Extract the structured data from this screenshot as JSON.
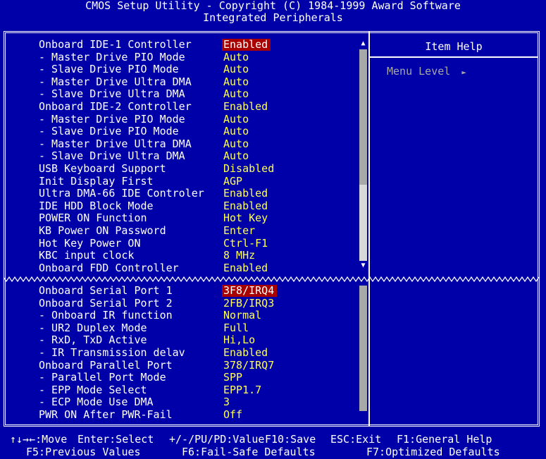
{
  "header": {
    "line1": "CMOS Setup Utility - Copyright (C) 1984-1999 Award Software",
    "line2": "Integrated Peripherals"
  },
  "help": {
    "title": "Item Help",
    "menu_level": "Menu Level"
  },
  "top_items": [
    {
      "label": "Onboard IDE-1 Controller",
      "value": "Enabled",
      "selected": true
    },
    {
      "label": "- Master Drive PIO Mode",
      "value": "Auto"
    },
    {
      "label": "- Slave Drive PIO Mode",
      "value": "Auto"
    },
    {
      "label": "- Master Drive Ultra DMA",
      "value": "Auto"
    },
    {
      "label": "- Slave Drive Ultra DMA",
      "value": "Auto"
    },
    {
      "label": "Onboard IDE-2 Controller",
      "value": "Enabled"
    },
    {
      "label": "- Master Drive PIO Mode",
      "value": "Auto"
    },
    {
      "label": "- Slave Drive PIO Mode",
      "value": "Auto"
    },
    {
      "label": "- Master Drive Ultra DMA",
      "value": "Auto"
    },
    {
      "label": "- Slave Drive Ultra DMA",
      "value": "Auto"
    },
    {
      "label": "USB Keyboard Support",
      "value": "Disabled"
    },
    {
      "label": "Init Display First",
      "value": "AGP"
    },
    {
      "label": "Ultra DMA-66 IDE Controler",
      "value": "Enabled"
    },
    {
      "label": "IDE HDD Block Mode",
      "value": "Enabled"
    },
    {
      "label": "POWER ON Function",
      "value": "Hot Key"
    },
    {
      "label": "KB Power ON Password",
      "value": "Enter"
    },
    {
      "label": "Hot Key Power ON",
      "value": "Ctrl-F1"
    },
    {
      "label": "KBC input clock",
      "value": "8 MHz"
    },
    {
      "label": "Onboard FDD Controller",
      "value": "Enabled"
    }
  ],
  "bottom_items": [
    {
      "label": "Onboard Serial Port 1",
      "value": "3F8/IRQ4",
      "selected": true
    },
    {
      "label": "Onboard Serial Port 2",
      "value": "2FB/IRQ3"
    },
    {
      "label": "- Onboard IR function",
      "value": "Normal"
    },
    {
      "label": "- UR2 Duplex Mode",
      "value": "Full"
    },
    {
      "label": "- RxD, TxD Active",
      "value": "Hi,Lo"
    },
    {
      "label": "- IR Transmission delav",
      "value": "Enabled"
    },
    {
      "label": "Onboard Parallel Port",
      "value": "378/IRQ7"
    },
    {
      "label": "- Parallel Port Mode",
      "value": "SPP"
    },
    {
      "label": "- EPP Mode Select",
      "value": "EPP1.7"
    },
    {
      "label": "- ECP Mode Use DMA",
      "value": "3"
    },
    {
      "label": "PWR ON After PWR-Fail",
      "value": "Off"
    }
  ],
  "footer": {
    "move": "↑↓→←:Move",
    "enter": "Enter:Select",
    "value": "+/-/PU/PD:Value",
    "save": "F10:Save",
    "exit": "ESC:Exit",
    "help": "F1:General Help",
    "prev": "F5:Previous Values",
    "failsafe": "F6:Fail-Safe Defaults",
    "optimized": "F7:Optimized Defaults"
  },
  "colors": {
    "background": "#0000a8",
    "label": "#ffffff",
    "value": "#ffff55",
    "selected_bg": "#a80000"
  }
}
